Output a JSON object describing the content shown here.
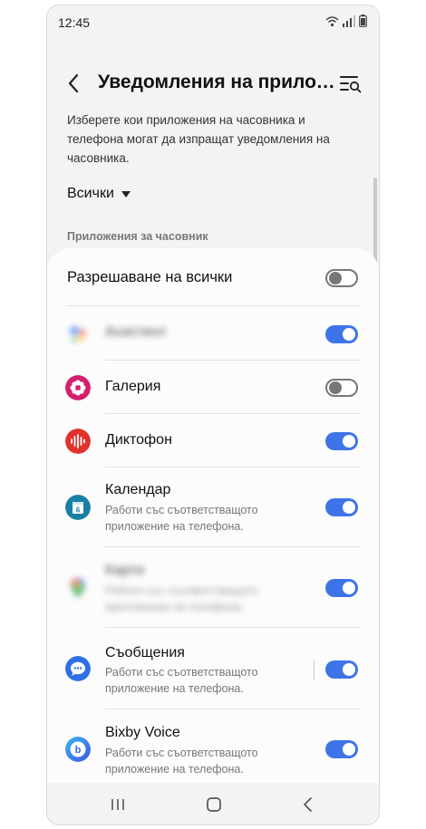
{
  "status_bar": {
    "time": "12:45",
    "icons": [
      "wifi-icon",
      "signal-icon",
      "battery-icon"
    ]
  },
  "header": {
    "title": "Уведомления на прилож...",
    "back_icon": "chevron-left-icon",
    "search_icon": "list-search-icon"
  },
  "description": "Изберете кои приложения на часовника и телефона могат да изпращат уведомления на часовника.",
  "filter": {
    "selected": "Всички"
  },
  "section_label": "Приложения за часовник",
  "allow_all": {
    "label": "Разрешаване на всички",
    "enabled": false
  },
  "apps": [
    {
      "name": "Асистент",
      "subtitle": "",
      "icon": "assistant-icon",
      "enabled": true,
      "blurred": true
    },
    {
      "name": "Галерия",
      "subtitle": "",
      "icon": "gallery-icon",
      "enabled": false,
      "blurred": false
    },
    {
      "name": "Диктофон",
      "subtitle": "",
      "icon": "voice-recorder-icon",
      "enabled": true,
      "blurred": false
    },
    {
      "name": "Календар",
      "subtitle": "Работи със съответстващото приложение на телефона.",
      "icon": "calendar-icon",
      "enabled": true,
      "blurred": false
    },
    {
      "name": "Карти",
      "subtitle": "Работи със съответстващото приложение на телефона.",
      "icon": "maps-icon",
      "enabled": true,
      "blurred": true
    },
    {
      "name": "Съобщения",
      "subtitle": "Работи със съответстващото приложение на телефона.",
      "icon": "messages-icon",
      "enabled": true,
      "blurred": false
    },
    {
      "name": "Bixby Voice",
      "subtitle": "Работи със съответстващото приложение на телефона.",
      "icon": "bixby-icon",
      "enabled": true,
      "blurred": false
    }
  ],
  "colors": {
    "accent": "#3e74e7",
    "background": "#f3f3f5",
    "card": "#fcfcfd"
  },
  "nav_bar": {
    "buttons": [
      "recents-icon",
      "home-icon",
      "back-icon"
    ]
  }
}
